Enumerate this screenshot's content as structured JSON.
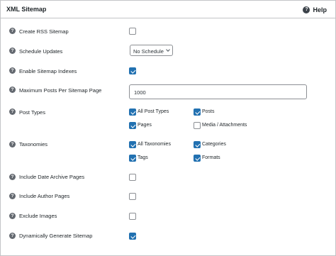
{
  "panel": {
    "title": "XML Sitemap",
    "help_label": "Help",
    "help_icon": "question-circle-icon"
  },
  "settings": [
    {
      "label": "Create RSS Sitemap",
      "type": "checkbox",
      "checked": false
    },
    {
      "label": "Schedule Updates",
      "type": "select",
      "value": "No Schedule"
    },
    {
      "label": "Enable Sitemap Indexes",
      "type": "checkbox",
      "checked": true
    },
    {
      "label": "Maximum Posts Per Sitemap Page",
      "type": "text",
      "value": "1000"
    },
    {
      "label": "Post Types",
      "type": "checkbox-group",
      "options": [
        {
          "label": "All Post Types",
          "checked": true
        },
        {
          "label": "Posts",
          "checked": true
        },
        {
          "label": "Pages",
          "checked": true
        },
        {
          "label": "Media / Attachments",
          "checked": false
        }
      ]
    },
    {
      "label": "Taxonomies",
      "type": "checkbox-group",
      "options": [
        {
          "label": "All Taxonomies",
          "checked": true
        },
        {
          "label": "Categories",
          "checked": true
        },
        {
          "label": "Tags",
          "checked": true
        },
        {
          "label": "Formats",
          "checked": true
        }
      ]
    },
    {
      "label": "Include Date Archive Pages",
      "type": "checkbox",
      "checked": false
    },
    {
      "label": "Include Author Pages",
      "type": "checkbox",
      "checked": false
    },
    {
      "label": "Exclude Images",
      "type": "checkbox",
      "checked": false
    },
    {
      "label": "Dynamically Generate Sitemap",
      "type": "checkbox",
      "checked": true
    }
  ],
  "colors": {
    "accent": "#2271b1",
    "help_icon": "#646970",
    "border": "#c3c4c7"
  }
}
